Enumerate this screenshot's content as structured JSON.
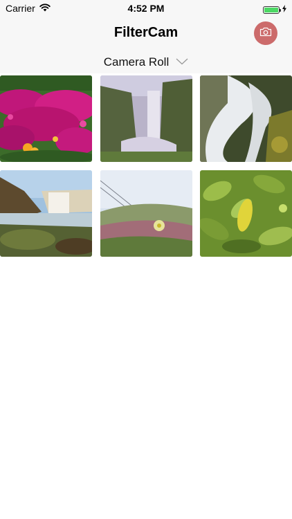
{
  "status_bar": {
    "carrier": "Carrier",
    "time": "4:52 PM",
    "battery_level": 1.0
  },
  "nav": {
    "title": "FilterCam",
    "camera_button_icon": "camera-icon",
    "accent_color": "#cc6b6b"
  },
  "album": {
    "label": "Camera Roll",
    "icon": "chevron-down-icon"
  },
  "photos": [
    {
      "subject": "flowers"
    },
    {
      "subject": "waterfall-cliff"
    },
    {
      "subject": "waterfall-closeup"
    },
    {
      "subject": "waterfall-coast"
    },
    {
      "subject": "hillside-flowers"
    },
    {
      "subject": "leaves"
    }
  ]
}
